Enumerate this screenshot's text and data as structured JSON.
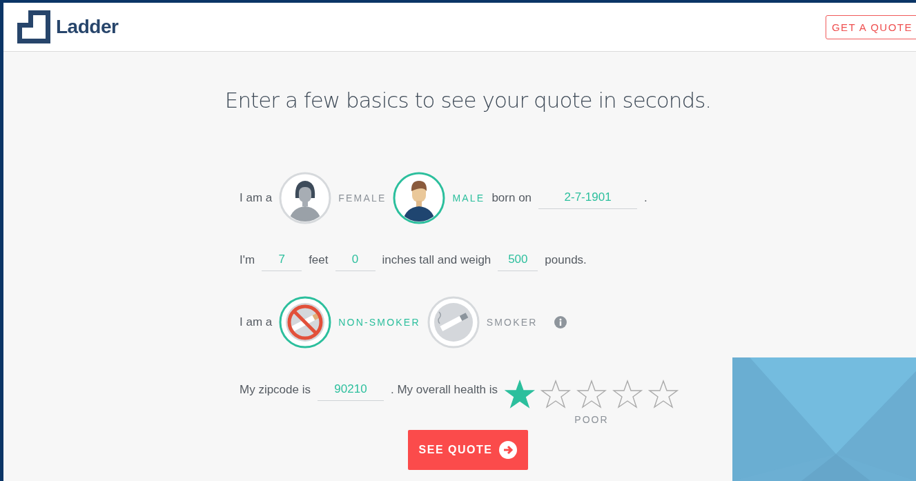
{
  "header": {
    "logo": "Ladder",
    "quote_button": "GET A QUOTE"
  },
  "title": "Enter a few basics to see your quote in seconds.",
  "gender": {
    "label": "I am a",
    "options": [
      {
        "label": "FEMALE",
        "kind": "female",
        "selected": false
      },
      {
        "label": "MALE",
        "kind": "male",
        "selected": true
      }
    ],
    "born_label": "born on",
    "birthdate": "2-7-1901",
    "end": "."
  },
  "size": {
    "prefix": "I'm",
    "feet": "7",
    "feet_label": "feet",
    "inches": "0",
    "inches_label": "inches tall and weigh",
    "weight": "500",
    "weight_label": "pounds."
  },
  "smoking": {
    "label": "I am a",
    "options": [
      {
        "label": "NON-SMOKER",
        "kind": "nonsmoker",
        "selected": true
      },
      {
        "label": "SMOKER",
        "kind": "smoker",
        "selected": false
      }
    ]
  },
  "health": {
    "zip_label": "My zipcode is",
    "zipcode": "90210",
    "health_label": ". My overall health is",
    "stars": 1,
    "rating_label": "POOR"
  },
  "submit": "SEE QUOTE"
}
